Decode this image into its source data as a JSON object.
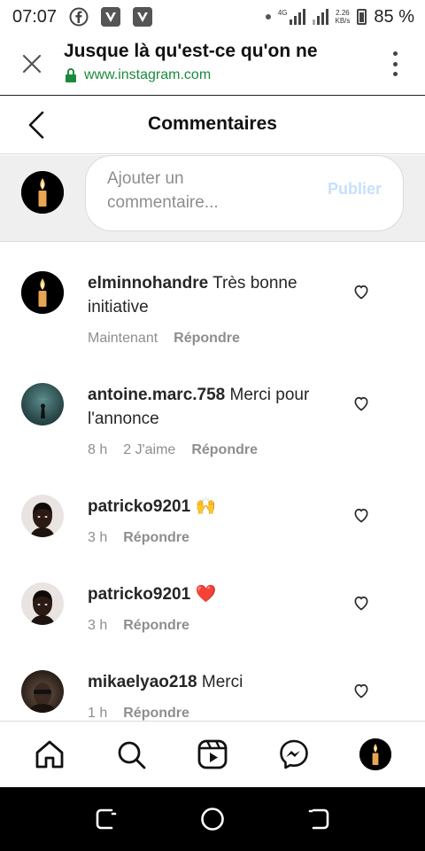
{
  "status_bar": {
    "time": "07:07",
    "network_type": "4G",
    "net_speed_value": "2.26",
    "net_speed_unit": "KB/s",
    "battery": "85 %",
    "battery_level": 0.85
  },
  "browser": {
    "title": "Jusque là qu'est-ce qu'on ne",
    "url": "www.instagram.com"
  },
  "header": {
    "title": "Commentaires"
  },
  "compose": {
    "placeholder": "Ajouter un commentaire...",
    "publish_label": "Publier"
  },
  "comments": [
    {
      "username": "elminnohandre",
      "text": " Très bonne initiative",
      "time": "Maintenant",
      "likes": "",
      "reply_label": "Répondre",
      "avatar": "candle"
    },
    {
      "username": "antoine.marc.758",
      "text": " Merci pour l'annonce",
      "time": "8 h",
      "likes": "2 J'aime",
      "reply_label": "Répondre",
      "avatar": "teal"
    },
    {
      "username": "patricko9201",
      "text": " 🙌",
      "time": "3 h",
      "likes": "",
      "reply_label": "Répondre",
      "avatar": "light"
    },
    {
      "username": "patricko9201",
      "text": " ❤️",
      "time": "3 h",
      "likes": "",
      "reply_label": "Répondre",
      "avatar": "light"
    },
    {
      "username": "mikaelyao218",
      "text": " Merci",
      "time": "1 h",
      "likes": "",
      "reply_label": "Répondre",
      "avatar": "dark"
    }
  ],
  "bottom_nav": {
    "items": [
      "home-icon",
      "search-icon",
      "reels-icon",
      "messenger-icon",
      "profile-avatar"
    ]
  },
  "colors": {
    "publish_disabled": "#c7e0fb",
    "secure_green": "#1b8a3f",
    "muted": "#8e8e8e",
    "text": "#262626"
  }
}
